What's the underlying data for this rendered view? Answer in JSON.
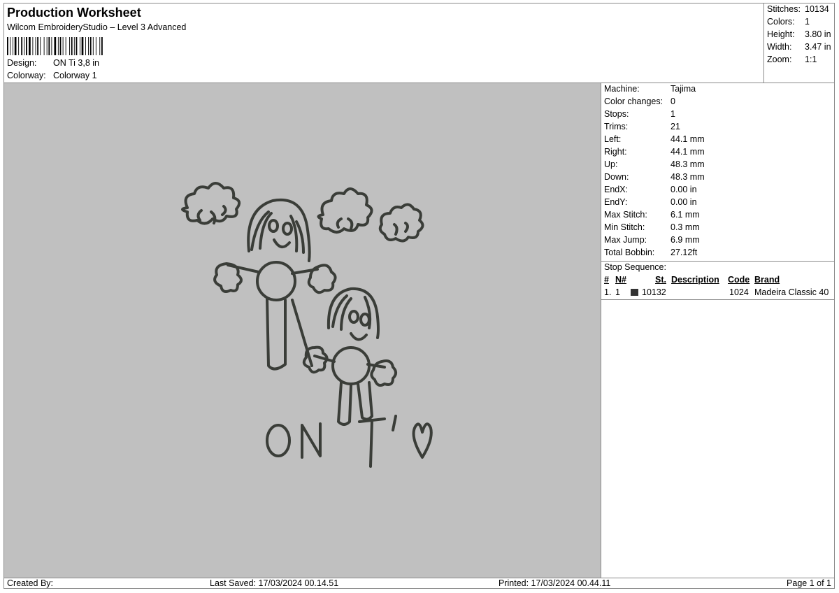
{
  "header": {
    "title": "Production Worksheet",
    "software": "Wilcom EmbroideryStudio – Level 3 Advanced",
    "design_label": "Design:",
    "design_value": "ON Ti 3,8 in",
    "colorway_label": "Colorway:",
    "colorway_value": "Colorway 1"
  },
  "stats": [
    {
      "label": "Stitches:",
      "value": "10134"
    },
    {
      "label": "Colors:",
      "value": "1"
    },
    {
      "label": "Height:",
      "value": "3.80 in"
    },
    {
      "label": "Width:",
      "value": "3.47 in"
    },
    {
      "label": "Zoom:",
      "value": "1:1"
    }
  ],
  "machine": [
    {
      "label": "Machine:",
      "value": "Tajima"
    },
    {
      "label": "Color changes:",
      "value": "0"
    },
    {
      "label": "Stops:",
      "value": "1"
    },
    {
      "label": "Trims:",
      "value": "21"
    },
    {
      "label": "Left:",
      "value": "44.1 mm"
    },
    {
      "label": "Right:",
      "value": "44.1 mm"
    },
    {
      "label": "Up:",
      "value": "48.3 mm"
    },
    {
      "label": "Down:",
      "value": "48.3 mm"
    },
    {
      "label": "EndX:",
      "value": "0.00 in"
    },
    {
      "label": "EndY:",
      "value": "0.00 in"
    },
    {
      "label": "Max Stitch:",
      "value": "6.1 mm"
    },
    {
      "label": "Min Stitch:",
      "value": "0.3 mm"
    },
    {
      "label": "Max Jump:",
      "value": "6.9 mm"
    },
    {
      "label": "Total Bobbin:",
      "value": "27.12ft"
    }
  ],
  "stop_sequence": {
    "title": "Stop Sequence:",
    "columns": {
      "num": "#",
      "n": "N#",
      "st": "St.",
      "description": "Description",
      "code": "Code",
      "brand": "Brand"
    },
    "rows": [
      {
        "num": "1.",
        "n": "1",
        "swatch_color": "#333333",
        "st": "10132",
        "description": "",
        "code": "1024",
        "brand": "Madeira Classic 40"
      }
    ]
  },
  "design_text": "ON T'",
  "thread_color": "#3a3d38",
  "canvas_color": "#c0c0c0",
  "footer": {
    "created_by": "Created By:",
    "last_saved": "Last Saved: 17/03/2024 00.14.51",
    "printed": "Printed: 17/03/2024 00.44.11",
    "page": "Page 1 of 1"
  }
}
